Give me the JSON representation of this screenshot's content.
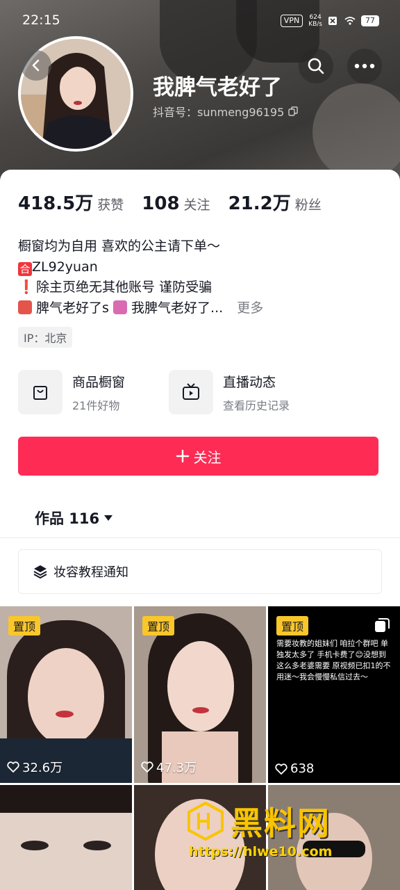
{
  "status_bar": {
    "time": "22:15",
    "vpn": "VPN",
    "speed_value": "624",
    "speed_unit": "KB/s",
    "battery": "77"
  },
  "profile": {
    "name": "我脾气老好了",
    "douyin_id": "抖音号：sunmeng96195"
  },
  "stats": [
    {
      "value": "418.5万",
      "label": "获赞"
    },
    {
      "value": "108",
      "label": "关注"
    },
    {
      "value": "21.2万",
      "label": "粉丝"
    }
  ],
  "bio": {
    "line1": "橱窗均为自用 喜欢的公主请下单～",
    "line2_tag": "合",
    "line2": "ZL92yuan",
    "line3_mark": "❗",
    "line3": "除主页绝无其他账号 谨防受骗",
    "line4_a": "脾气老好了s",
    "line4_b": "我脾气老好了...",
    "more": "更多"
  },
  "ip": "IP：北京",
  "features": [
    {
      "title": "商品橱窗",
      "sub": "21件好物",
      "icon": "shopping-bag-icon"
    },
    {
      "title": "直播动态",
      "sub": "查看历史记录",
      "icon": "tv-icon"
    }
  ],
  "follow_button": "关注",
  "works_tab": "作品 116",
  "collection": "妆容教程通知",
  "videos": [
    {
      "pinned": "置顶",
      "likes": "32.6万"
    },
    {
      "pinned": "置顶",
      "likes": "47.3万"
    },
    {
      "pinned": "置顶",
      "likes": "638",
      "caption": "需要妆教的姐妹们 咱拉个群吧 单独发太多了 手机卡费了😊没想到这么多老婆需要 原视频已扣1的不用迷～我会慢慢私信过去～"
    }
  ],
  "watermark": {
    "title": "黑料网",
    "url": "https://hlwe10.com"
  },
  "colors": {
    "accent": "#fe2c55",
    "pin": "#f9c62b"
  }
}
